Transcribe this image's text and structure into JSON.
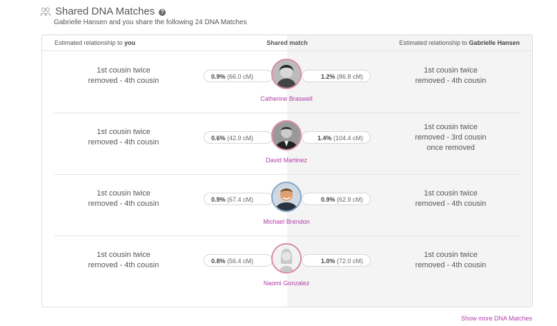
{
  "header": {
    "title": "Shared DNA Matches",
    "help": "?",
    "subtitle": "Gabrielle Hansen and you share the following 24 DNA Matches"
  },
  "table": {
    "col_left_prefix": "Estimated relationship to ",
    "col_left_bold": "you",
    "col_mid": "Shared match",
    "col_right_prefix": "Estimated relationship to ",
    "col_right_bold": "Gabrielle Hansen"
  },
  "matches": [
    {
      "name": "Catherine Braswell",
      "rel_you": [
        "1st cousin twice",
        "removed - 4th cousin"
      ],
      "rel_other": [
        "1st cousin twice",
        "removed - 4th cousin"
      ],
      "you_pct": "0.9%",
      "you_cm": "(66.0 cM)",
      "other_pct": "1.2%",
      "other_cm": "(86.8 cM)",
      "avatar": "photo-woman-bw"
    },
    {
      "name": "David Martinez",
      "rel_you": [
        "1st cousin twice",
        "removed - 4th cousin"
      ],
      "rel_other": [
        "1st cousin twice",
        "removed - 3rd cousin",
        "once removed"
      ],
      "you_pct": "0.6%",
      "you_cm": "(42.9 cM)",
      "other_pct": "1.4%",
      "other_cm": "(104.4 cM)",
      "avatar": "photo-man-bw"
    },
    {
      "name": "Michael Brendon",
      "rel_you": [
        "1st cousin twice",
        "removed - 4th cousin"
      ],
      "rel_other": [
        "1st cousin twice",
        "removed - 4th cousin"
      ],
      "you_pct": "0.9%",
      "you_cm": "(67.4 cM)",
      "other_pct": "0.9%",
      "other_cm": "(62.9 cM)",
      "avatar": "photo-man-color"
    },
    {
      "name": "Naomi Gonzalez",
      "rel_you": [
        "1st cousin twice",
        "removed - 4th cousin"
      ],
      "rel_other": [
        "1st cousin twice",
        "removed - 4th cousin"
      ],
      "you_pct": "0.8%",
      "you_cm": "(56.4 cM)",
      "other_pct": "1.0%",
      "other_cm": "(72.0 cM)",
      "avatar": "placeholder-woman-icon"
    }
  ],
  "footer": {
    "show_more": "Show more DNA Matches"
  },
  "colors": {
    "accent": "#b23da9",
    "female_ring": "#d9899b",
    "male_ring": "#7fa6c8"
  }
}
